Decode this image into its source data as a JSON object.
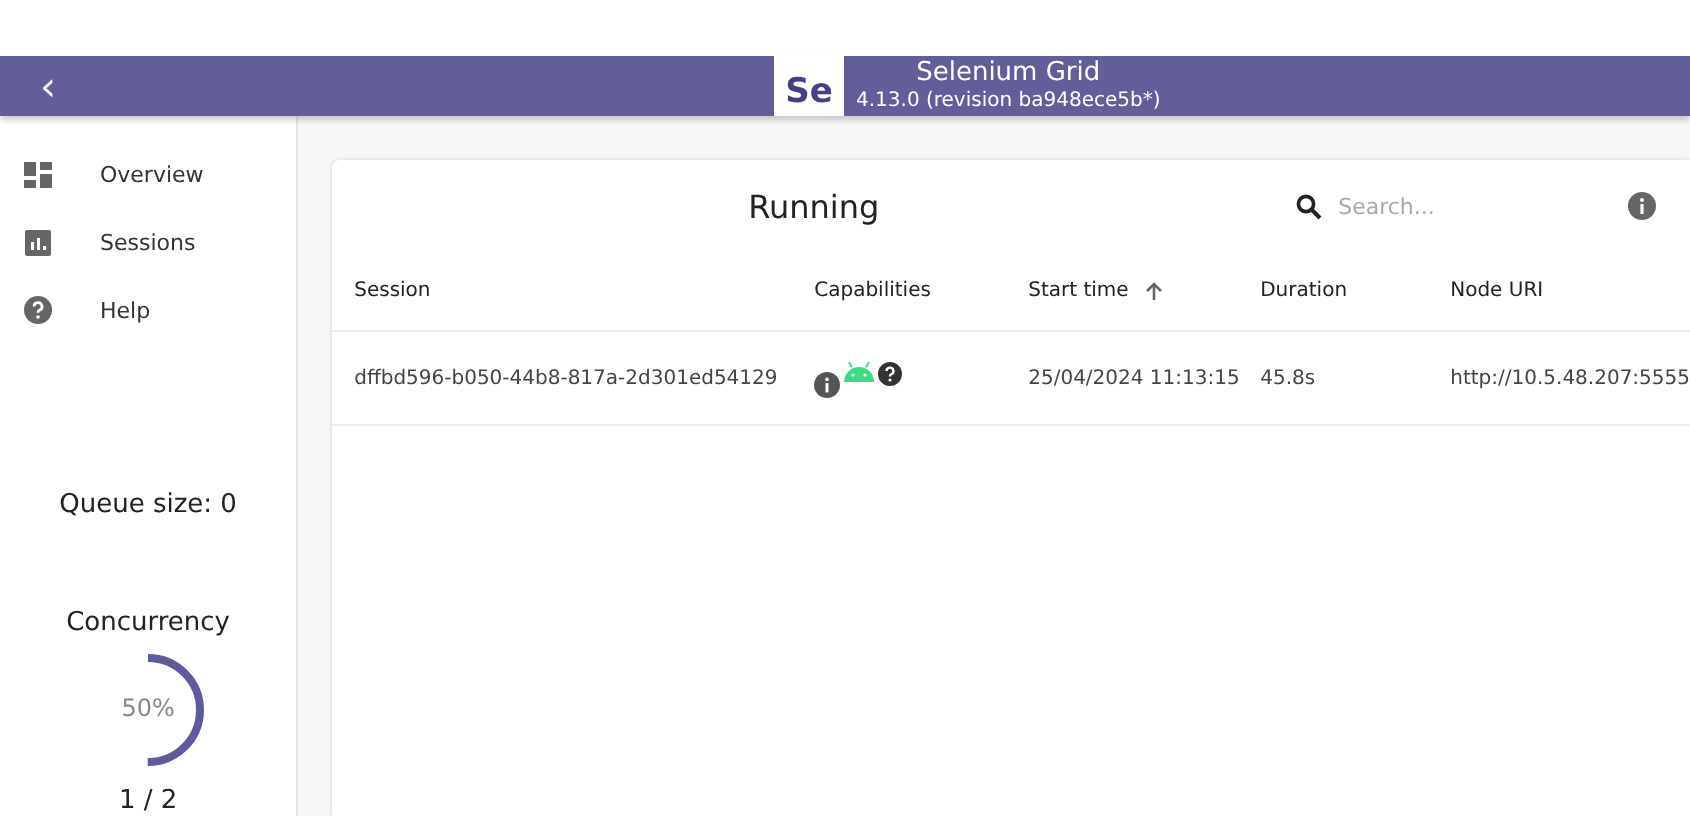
{
  "header": {
    "back": "‹",
    "logo": "Se",
    "title": "Selenium Grid",
    "version": "4.13.0 (revision ba948ece5b*)"
  },
  "sidebar": {
    "items": [
      {
        "label": "Overview",
        "kind": "dashboard"
      },
      {
        "label": "Sessions",
        "kind": "chart"
      },
      {
        "label": "Help",
        "kind": "help"
      }
    ],
    "queue": "Queue size: 0",
    "concurrency": {
      "title": "Concurrency",
      "level": 0.5,
      "percent": "50%",
      "count": "1 / 2"
    }
  },
  "sessions": {
    "title": "Running",
    "search": {
      "placeholder": "Search..."
    },
    "columns": [
      {
        "label": "Session",
        "sorted": false
      },
      {
        "label": "Capabilities",
        "sorted": false
      },
      {
        "label": "Start time",
        "sorted": true
      },
      {
        "label": "Duration",
        "sorted": false
      },
      {
        "label": "Node URI",
        "sorted": false
      }
    ],
    "rows": [
      {
        "session": "dffbd596-b050-44b8-817a-2d301ed54129",
        "start": "25/04/2024 11:13:15",
        "duration": "45.8s",
        "node": "http://10.5.48.207:5555"
      }
    ]
  }
}
